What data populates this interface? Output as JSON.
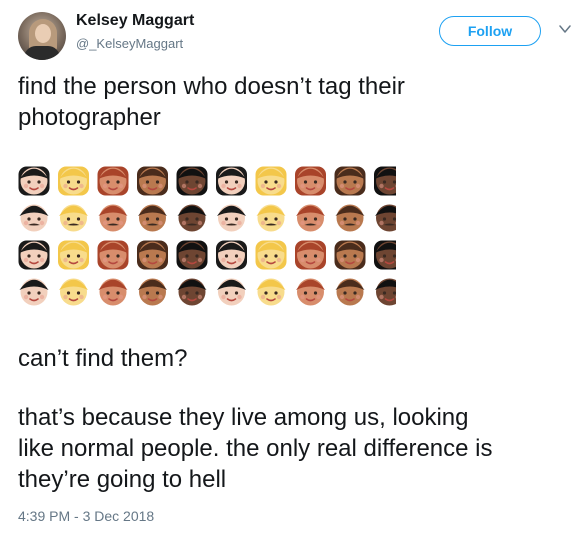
{
  "user": {
    "display_name": "Kelsey Maggart",
    "handle": "@_KelseyMaggart",
    "follow_label": "Follow"
  },
  "tweet": {
    "line1": "find the person who doesn’t tag their\nphotographer",
    "line2": "can’t find them?",
    "line3": "that’s because they live among us, looking\nlike normal people. the only real difference is\nthey’re going to hell",
    "timestamp": "4:39 PM - 3 Dec 2018"
  },
  "emoji_grid": {
    "rows": [
      "woman",
      "man-mustache",
      "woman-long-hair",
      "boy"
    ],
    "skin_tones": [
      "#f2d0bd",
      "#f8dc8c",
      "#d88d6c",
      "#b9794f",
      "#6e4532",
      "#f2d0bd",
      "#f8dc8c",
      "#d88d6c",
      "#b9794f",
      "#6e4532"
    ],
    "hair_colors": [
      "#1a1a1a",
      "#f3c74a",
      "#a9442a",
      "#4a2c1c",
      "#111111",
      "#1a1a1a",
      "#f3c74a",
      "#a9442a",
      "#4a2c1c",
      "#111111"
    ]
  },
  "colors": {
    "accent": "#1da1f2",
    "text": "#14171a",
    "muted": "#657786"
  }
}
